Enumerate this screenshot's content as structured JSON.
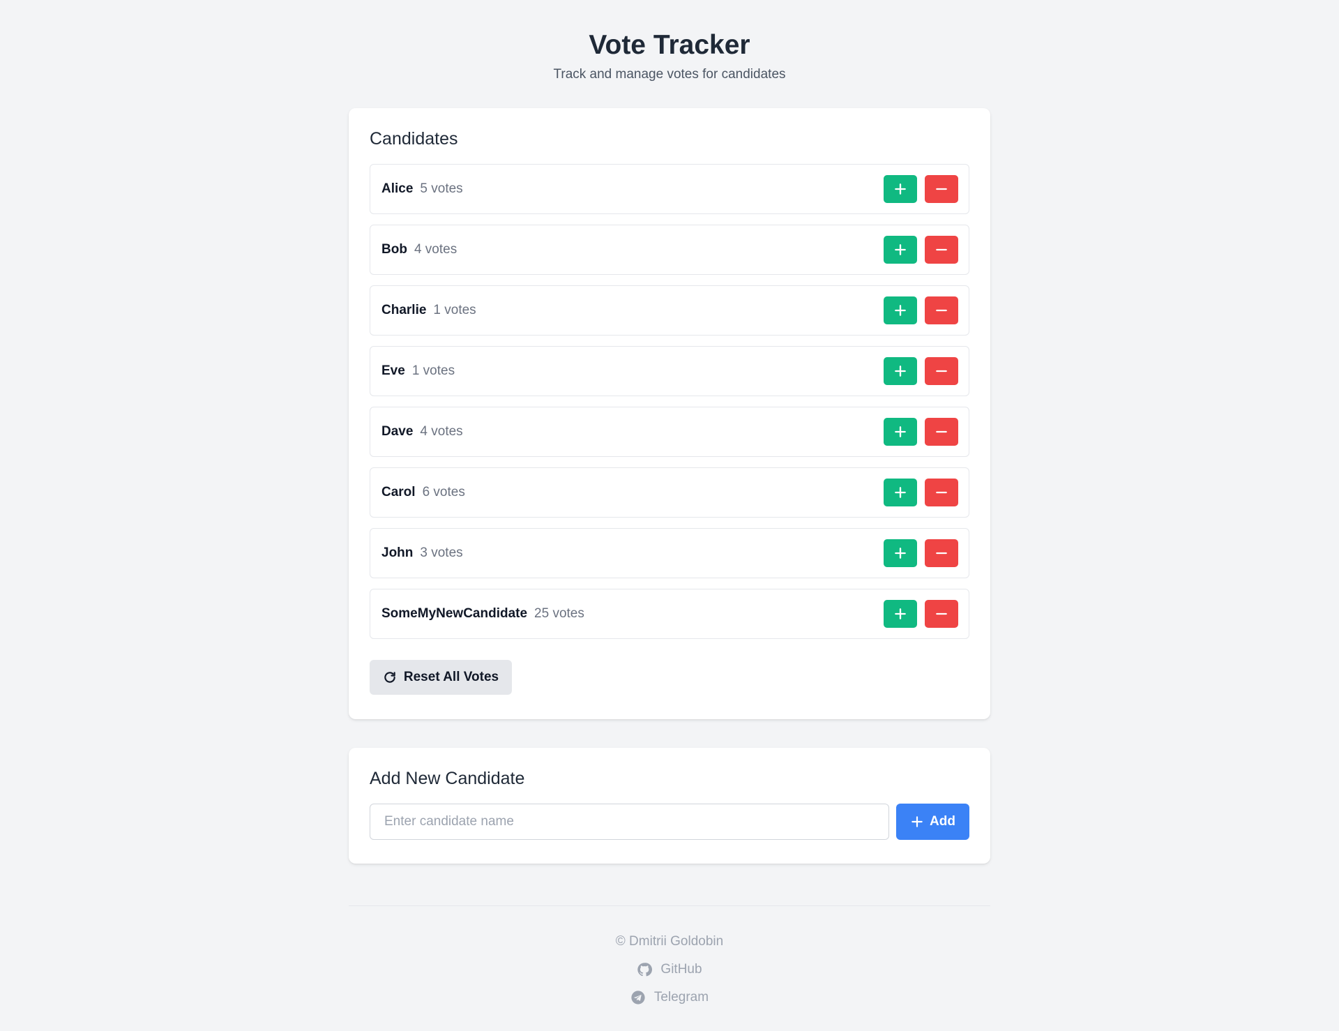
{
  "header": {
    "title": "Vote Tracker",
    "subtitle": "Track and manage votes for candidates"
  },
  "candidates_section": {
    "title": "Candidates",
    "items": [
      {
        "name": "Alice",
        "votes": "5 votes"
      },
      {
        "name": "Bob",
        "votes": "4 votes"
      },
      {
        "name": "Charlie",
        "votes": "1 votes"
      },
      {
        "name": "Eve",
        "votes": "1 votes"
      },
      {
        "name": "Dave",
        "votes": "4 votes"
      },
      {
        "name": "Carol",
        "votes": "6 votes"
      },
      {
        "name": "John",
        "votes": "3 votes"
      },
      {
        "name": "SomeMyNewCandidate",
        "votes": "25 votes"
      }
    ],
    "reset_label": "Reset All Votes"
  },
  "add_section": {
    "title": "Add New Candidate",
    "input_placeholder": "Enter candidate name",
    "input_value": "",
    "add_label": "Add"
  },
  "footer": {
    "copyright": "© Dmitrii Goldobin",
    "github_label": "GitHub",
    "telegram_label": "Telegram"
  },
  "colors": {
    "plus_button": "#10b981",
    "minus_button": "#ef4444",
    "add_button": "#3b82f6",
    "background": "#f3f4f6"
  },
  "icons": {
    "vote_up": "plus-icon",
    "vote_down": "minus-icon",
    "reset": "refresh-icon",
    "add": "plus-icon",
    "github": "github-icon",
    "telegram": "telegram-icon"
  }
}
